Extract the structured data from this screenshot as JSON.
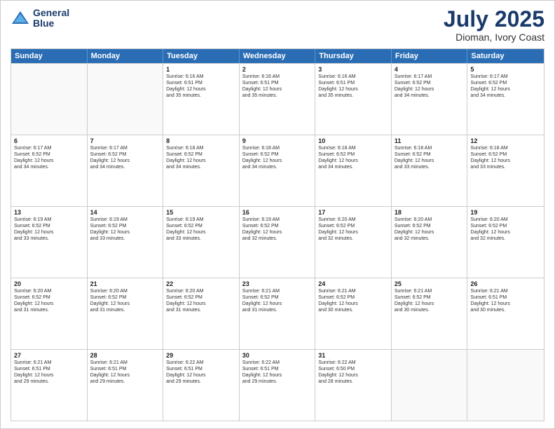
{
  "header": {
    "logo_line1": "General",
    "logo_line2": "Blue",
    "month": "July 2025",
    "location": "Dioman, Ivory Coast"
  },
  "weekdays": [
    "Sunday",
    "Monday",
    "Tuesday",
    "Wednesday",
    "Thursday",
    "Friday",
    "Saturday"
  ],
  "weeks": [
    [
      {
        "date": "",
        "info": ""
      },
      {
        "date": "",
        "info": ""
      },
      {
        "date": "1",
        "info": "Sunrise: 6:16 AM\nSunset: 6:51 PM\nDaylight: 12 hours\nand 35 minutes."
      },
      {
        "date": "2",
        "info": "Sunrise: 6:16 AM\nSunset: 6:51 PM\nDaylight: 12 hours\nand 35 minutes."
      },
      {
        "date": "3",
        "info": "Sunrise: 6:16 AM\nSunset: 6:51 PM\nDaylight: 12 hours\nand 35 minutes."
      },
      {
        "date": "4",
        "info": "Sunrise: 6:17 AM\nSunset: 6:52 PM\nDaylight: 12 hours\nand 34 minutes."
      },
      {
        "date": "5",
        "info": "Sunrise: 6:17 AM\nSunset: 6:52 PM\nDaylight: 12 hours\nand 34 minutes."
      }
    ],
    [
      {
        "date": "6",
        "info": "Sunrise: 6:17 AM\nSunset: 6:52 PM\nDaylight: 12 hours\nand 34 minutes."
      },
      {
        "date": "7",
        "info": "Sunrise: 6:17 AM\nSunset: 6:52 PM\nDaylight: 12 hours\nand 34 minutes."
      },
      {
        "date": "8",
        "info": "Sunrise: 6:18 AM\nSunset: 6:52 PM\nDaylight: 12 hours\nand 34 minutes."
      },
      {
        "date": "9",
        "info": "Sunrise: 6:18 AM\nSunset: 6:52 PM\nDaylight: 12 hours\nand 34 minutes."
      },
      {
        "date": "10",
        "info": "Sunrise: 6:18 AM\nSunset: 6:52 PM\nDaylight: 12 hours\nand 34 minutes."
      },
      {
        "date": "11",
        "info": "Sunrise: 6:18 AM\nSunset: 6:52 PM\nDaylight: 12 hours\nand 33 minutes."
      },
      {
        "date": "12",
        "info": "Sunrise: 6:18 AM\nSunset: 6:52 PM\nDaylight: 12 hours\nand 33 minutes."
      }
    ],
    [
      {
        "date": "13",
        "info": "Sunrise: 6:19 AM\nSunset: 6:52 PM\nDaylight: 12 hours\nand 33 minutes."
      },
      {
        "date": "14",
        "info": "Sunrise: 6:19 AM\nSunset: 6:52 PM\nDaylight: 12 hours\nand 33 minutes."
      },
      {
        "date": "15",
        "info": "Sunrise: 6:19 AM\nSunset: 6:52 PM\nDaylight: 12 hours\nand 33 minutes."
      },
      {
        "date": "16",
        "info": "Sunrise: 6:19 AM\nSunset: 6:52 PM\nDaylight: 12 hours\nand 32 minutes."
      },
      {
        "date": "17",
        "info": "Sunrise: 6:20 AM\nSunset: 6:52 PM\nDaylight: 12 hours\nand 32 minutes."
      },
      {
        "date": "18",
        "info": "Sunrise: 6:20 AM\nSunset: 6:52 PM\nDaylight: 12 hours\nand 32 minutes."
      },
      {
        "date": "19",
        "info": "Sunrise: 6:20 AM\nSunset: 6:52 PM\nDaylight: 12 hours\nand 32 minutes."
      }
    ],
    [
      {
        "date": "20",
        "info": "Sunrise: 6:20 AM\nSunset: 6:52 PM\nDaylight: 12 hours\nand 31 minutes."
      },
      {
        "date": "21",
        "info": "Sunrise: 6:20 AM\nSunset: 6:52 PM\nDaylight: 12 hours\nand 31 minutes."
      },
      {
        "date": "22",
        "info": "Sunrise: 6:20 AM\nSunset: 6:52 PM\nDaylight: 12 hours\nand 31 minutes."
      },
      {
        "date": "23",
        "info": "Sunrise: 6:21 AM\nSunset: 6:52 PM\nDaylight: 12 hours\nand 31 minutes."
      },
      {
        "date": "24",
        "info": "Sunrise: 6:21 AM\nSunset: 6:52 PM\nDaylight: 12 hours\nand 30 minutes."
      },
      {
        "date": "25",
        "info": "Sunrise: 6:21 AM\nSunset: 6:52 PM\nDaylight: 12 hours\nand 30 minutes."
      },
      {
        "date": "26",
        "info": "Sunrise: 6:21 AM\nSunset: 6:51 PM\nDaylight: 12 hours\nand 30 minutes."
      }
    ],
    [
      {
        "date": "27",
        "info": "Sunrise: 6:21 AM\nSunset: 6:51 PM\nDaylight: 12 hours\nand 29 minutes."
      },
      {
        "date": "28",
        "info": "Sunrise: 6:21 AM\nSunset: 6:51 PM\nDaylight: 12 hours\nand 29 minutes."
      },
      {
        "date": "29",
        "info": "Sunrise: 6:22 AM\nSunset: 6:51 PM\nDaylight: 12 hours\nand 29 minutes."
      },
      {
        "date": "30",
        "info": "Sunrise: 6:22 AM\nSunset: 6:51 PM\nDaylight: 12 hours\nand 29 minutes."
      },
      {
        "date": "31",
        "info": "Sunrise: 6:22 AM\nSunset: 6:50 PM\nDaylight: 12 hours\nand 28 minutes."
      },
      {
        "date": "",
        "info": ""
      },
      {
        "date": "",
        "info": ""
      }
    ]
  ]
}
